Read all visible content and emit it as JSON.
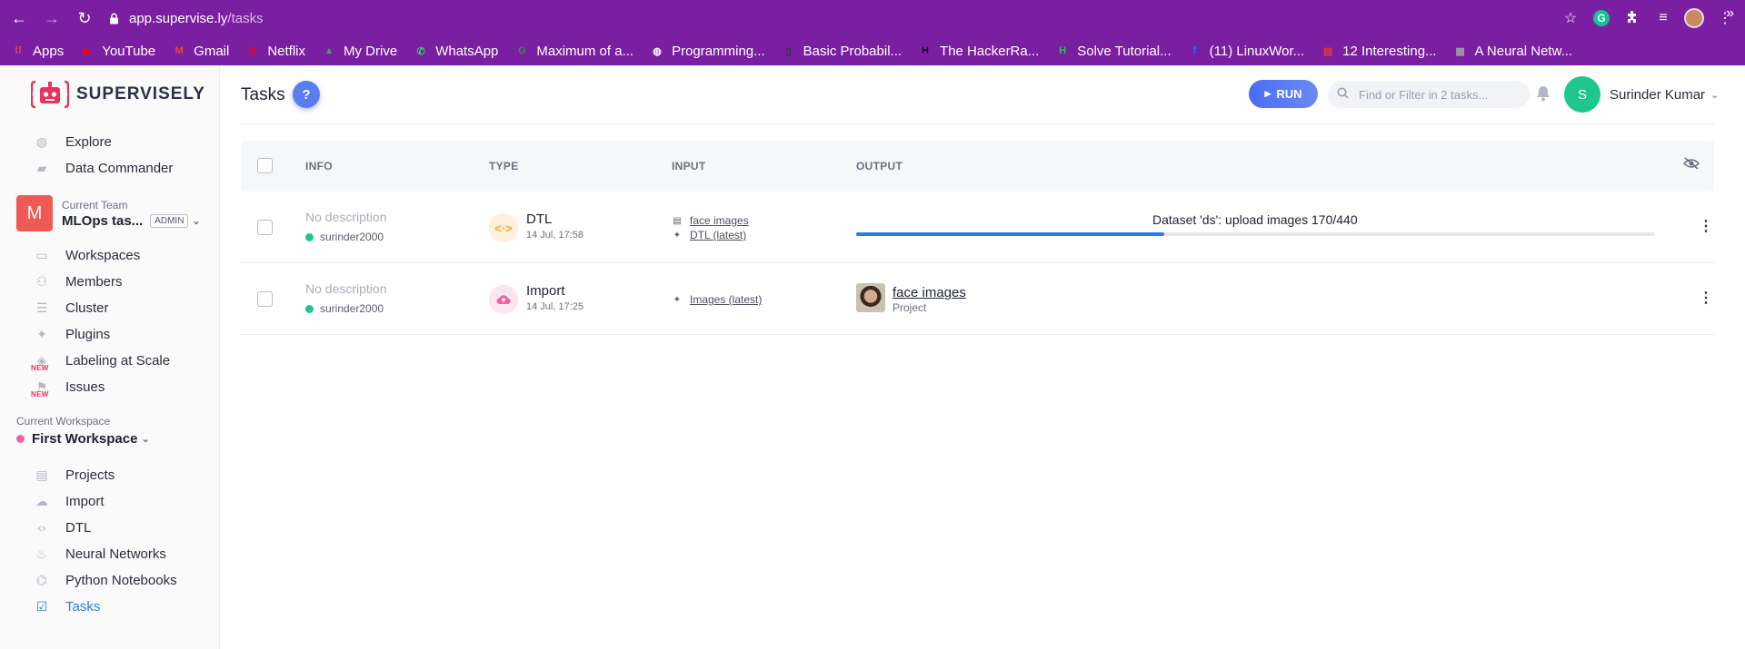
{
  "browser": {
    "url_host": "app.supervise.ly",
    "url_path": "/tasks",
    "bookmarks": [
      {
        "label": "Apps",
        "icon": "apps-grid-icon",
        "color": "#ff5252"
      },
      {
        "label": "YouTube",
        "icon": "youtube-icon",
        "color": "#ff0000"
      },
      {
        "label": "Gmail",
        "icon": "gmail-icon",
        "color": "#ea4335"
      },
      {
        "label": "Netflix",
        "icon": "netflix-icon",
        "color": "#e50914"
      },
      {
        "label": "My Drive",
        "icon": "drive-icon",
        "color": "#34a853"
      },
      {
        "label": "WhatsApp",
        "icon": "whatsapp-icon",
        "color": "#25d366"
      },
      {
        "label": "Maximum of a...",
        "icon": "gfg-icon",
        "color": "#2f8d46"
      },
      {
        "label": "Programming...",
        "icon": "globe-icon",
        "color": "#ffffff"
      },
      {
        "label": "Basic Probabil...",
        "icon": "bookmark-page-icon",
        "color": "#333333"
      },
      {
        "label": "The HackerRa...",
        "icon": "hackerrank-icon",
        "color": "#0e141e"
      },
      {
        "label": "Solve Tutorial...",
        "icon": "hackerearth-icon",
        "color": "#2bbd5a"
      },
      {
        "label": "(11) LinuxWor...",
        "icon": "facebook-icon",
        "color": "#1877f2"
      },
      {
        "label": "12 Interesting...",
        "icon": "pdf-icon",
        "color": "#e53935"
      },
      {
        "label": "A Neural Netw...",
        "icon": "page-icon",
        "color": "#9e9e9e"
      }
    ]
  },
  "sidebar": {
    "brand": "SUPERVISELY",
    "top_items": [
      {
        "label": "Explore",
        "icon": "globe-icon"
      },
      {
        "label": "Data Commander",
        "icon": "folder-icon"
      }
    ],
    "team": {
      "label": "Current Team",
      "avatar_letter": "M",
      "name": "MLOps tas...",
      "role": "ADMIN"
    },
    "team_items": [
      {
        "label": "Workspaces",
        "icon": "monitor-icon"
      },
      {
        "label": "Members",
        "icon": "members-icon"
      },
      {
        "label": "Cluster",
        "icon": "list-icon"
      },
      {
        "label": "Plugins",
        "icon": "puzzle-icon"
      },
      {
        "label": "Labeling at Scale",
        "icon": "graduation-cap-icon",
        "badge": "NEW"
      },
      {
        "label": "Issues",
        "icon": "flag-icon",
        "badge": "NEW"
      }
    ],
    "workspace": {
      "label": "Current Workspace",
      "name": "First Workspace"
    },
    "workspace_items": [
      {
        "label": "Projects",
        "icon": "images-icon"
      },
      {
        "label": "Import",
        "icon": "cloud-upload-icon"
      },
      {
        "label": "DTL",
        "icon": "code-icon"
      },
      {
        "label": "Neural Networks",
        "icon": "flame-icon"
      },
      {
        "label": "Python Notebooks",
        "icon": "python-icon"
      },
      {
        "label": "Tasks",
        "icon": "checkbox-icon",
        "active": true
      }
    ]
  },
  "header": {
    "title": "Tasks",
    "help": "?",
    "run_label": "RUN",
    "search_placeholder": "Find or Filter in 2 tasks...",
    "user_initial": "S",
    "user_name": "Surinder Kumar"
  },
  "table": {
    "columns": [
      "INFO",
      "TYPE",
      "INPUT",
      "OUTPUT"
    ],
    "rows": [
      {
        "description": "No description",
        "user": "surinder2000",
        "type": "DTL",
        "type_color": "#f5a623",
        "type_bg": "#fdf0dc",
        "date": "14 Jul, 17:58",
        "inputs": [
          {
            "label": "face images",
            "icon": "images-icon"
          },
          {
            "label": "DTL (latest)",
            "icon": "puzzle-icon"
          }
        ],
        "output_text": "Dataset 'ds': upload images 170/440",
        "progress": 0.386
      },
      {
        "description": "No description",
        "user": "surinder2000",
        "type": "Import",
        "type_color": "#f062a8",
        "type_bg": "#fde5f1",
        "date": "14 Jul, 17:25",
        "inputs": [
          {
            "label": "Images (latest)",
            "icon": "puzzle-icon"
          }
        ],
        "output_project": "face images",
        "output_sub": "Project"
      }
    ]
  },
  "colors": {
    "chrome": "#7b1fa2",
    "accent": "#2c7be5",
    "run": "#4a6cf7",
    "status_green": "#1ec78e"
  }
}
